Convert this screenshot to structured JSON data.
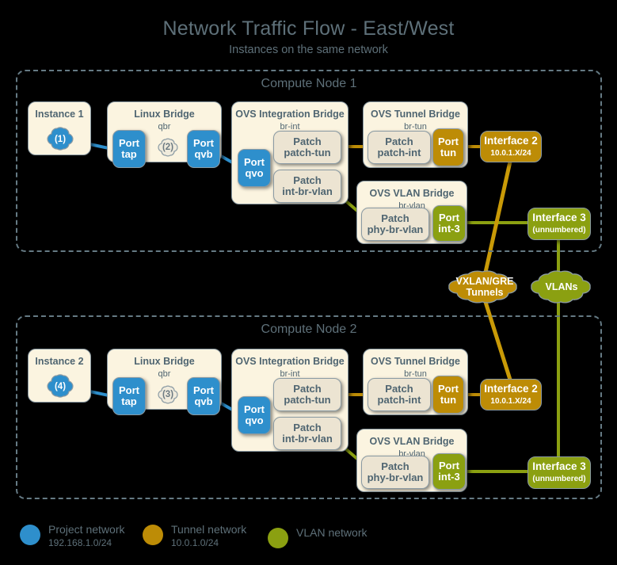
{
  "header": {
    "title": "Network Traffic Flow - East/West",
    "subtitle": "Instances on the same network"
  },
  "colors": {
    "project_network": "#2e8fcc",
    "tunnel_network": "#bd8c06",
    "vlan_network": "#8ba011",
    "panel_bg": "#fbf4e0",
    "patch_bg": "#ece4d2",
    "outline": "#8a9aa3",
    "text": "#5e7079",
    "background": "#000000"
  },
  "nodes": [
    {
      "id": "compute-node-1",
      "title": "Compute Node 1",
      "instance": {
        "title": "Instance 1",
        "cloud_label": "(1)"
      },
      "linux_bridge": {
        "title": "Linux Bridge",
        "subtitle": "qbr",
        "port_tap": "Port\ntap",
        "cloud_label": "(2)",
        "port_qvb": "Port\nqvb"
      },
      "integration_bridge": {
        "title": "OVS Integration Bridge",
        "subtitle": "br-int",
        "port_qvo": "Port\nqvo",
        "patch_tun": "Patch\npatch-tun",
        "patch_vlan": "Patch\nint-br-vlan"
      },
      "tunnel_bridge": {
        "title": "OVS Tunnel Bridge",
        "subtitle": "br-tun",
        "patch_int": "Patch\npatch-int",
        "port_tun": "Port\ntun"
      },
      "vlan_bridge": {
        "title": "OVS VLAN Bridge",
        "subtitle": "br-vlan",
        "patch_phy": "Patch\nphy-br-vlan",
        "port_int3": "Port\nint-3"
      },
      "interface2": {
        "name": "Interface 2",
        "sub": "10.0.1.X/24"
      },
      "interface3": {
        "name": "Interface 3",
        "sub": "(unnumbered)"
      }
    },
    {
      "id": "compute-node-2",
      "title": "Compute Node 2",
      "instance": {
        "title": "Instance 2",
        "cloud_label": "(4)"
      },
      "linux_bridge": {
        "title": "Linux Bridge",
        "subtitle": "qbr",
        "port_tap": "Port\ntap",
        "cloud_label": "(3)",
        "port_qvb": "Port\nqvb"
      },
      "integration_bridge": {
        "title": "OVS Integration Bridge",
        "subtitle": "br-int",
        "port_qvo": "Port\nqvo",
        "patch_tun": "Patch\npatch-tun",
        "patch_vlan": "Patch\nint-br-vlan"
      },
      "tunnel_bridge": {
        "title": "OVS Tunnel Bridge",
        "subtitle": "br-tun",
        "patch_int": "Patch\npatch-int",
        "port_tun": "Port\ntun"
      },
      "vlan_bridge": {
        "title": "OVS VLAN Bridge",
        "subtitle": "br-vlan",
        "patch_phy": "Patch\nphy-br-vlan",
        "port_int3": "Port\nint-3"
      },
      "interface2": {
        "name": "Interface 2",
        "sub": "10.0.1.X/24"
      },
      "interface3": {
        "name": "Interface 3",
        "sub": "(unnumbered)"
      }
    }
  ],
  "clouds": {
    "tunnels": "VXLAN/GRE\nTunnels",
    "vlans": "VLANs"
  },
  "legend": [
    {
      "name": "Project network",
      "sub": "192.168.1.0/24",
      "color": "#2e8fcc"
    },
    {
      "name": "Tunnel network",
      "sub": "10.0.1.0/24",
      "color": "#bd8c06"
    },
    {
      "name": "VLAN network",
      "sub": "",
      "color": "#8ba011"
    }
  ]
}
